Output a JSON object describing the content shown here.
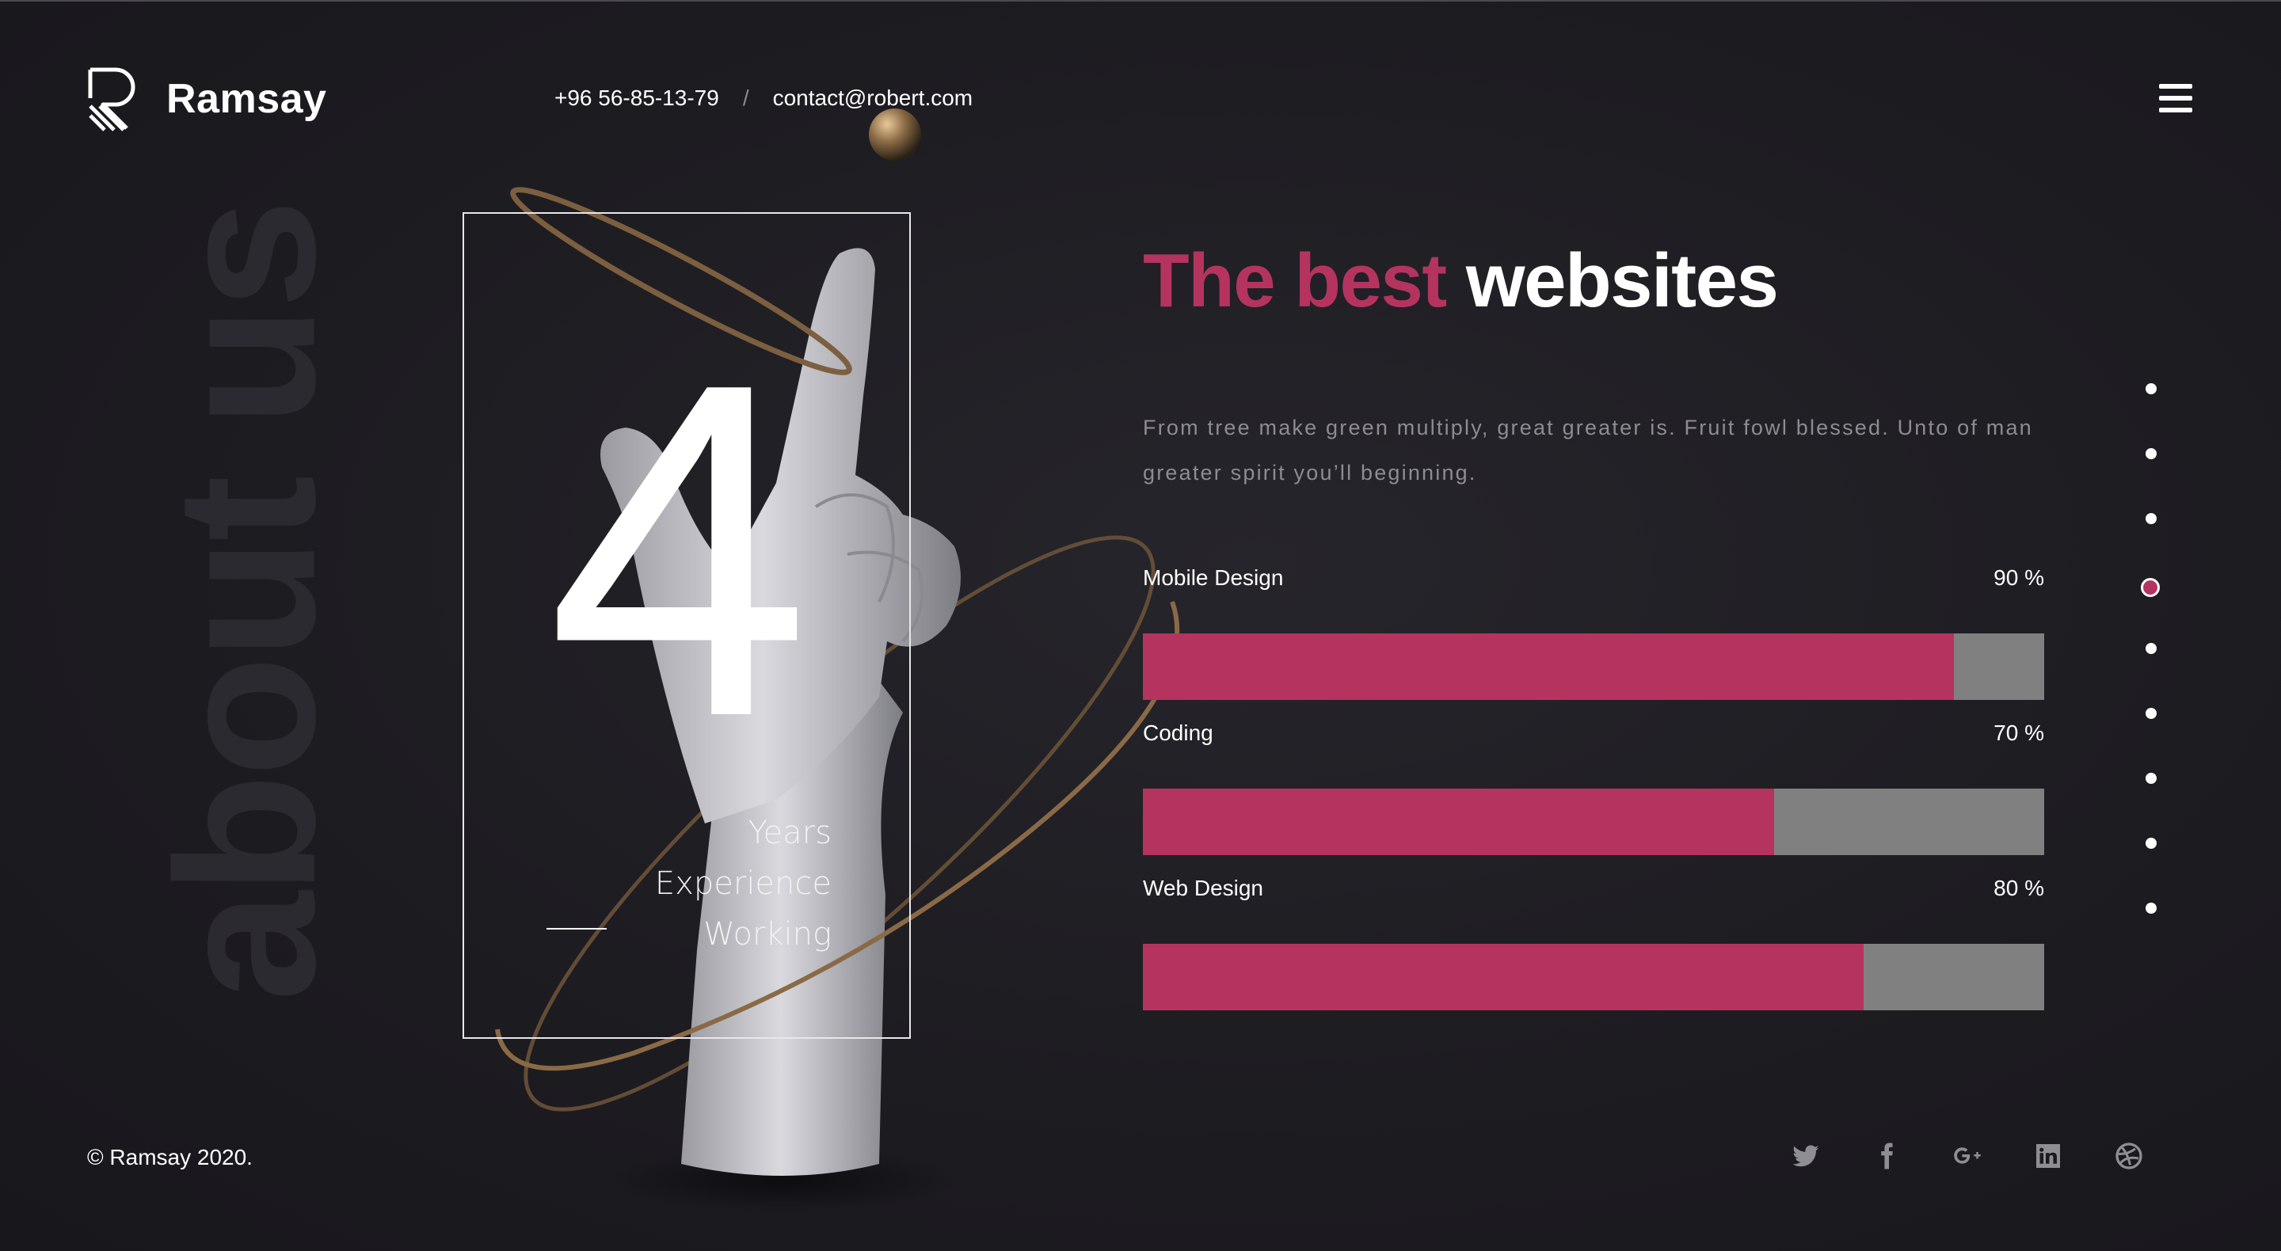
{
  "brand": {
    "name": "Ramsay"
  },
  "header": {
    "phone": "+96 56-85-13-79",
    "separator": "/",
    "email": "contact@robert.com"
  },
  "side_title": "about us",
  "experience": {
    "number": "4",
    "line1": "Years",
    "line2": "Experience",
    "line3": "Working"
  },
  "content": {
    "heading_accent": "The best",
    "heading_rest": "websites",
    "description": "From tree make green multiply, great greater is. Fruit fowl blessed. Unto of man greater spirit you’ll beginning.",
    "skills": [
      {
        "label": "Mobile Design",
        "value_text": "90 %",
        "value": 0.9
      },
      {
        "label": "Coding",
        "value_text": "70 %",
        "value": 0.7
      },
      {
        "label": "Web Design",
        "value_text": "80 %",
        "value": 0.8
      }
    ]
  },
  "pagination": {
    "count": 9,
    "active_index": 3
  },
  "footer": {
    "copyright": "© Ramsay 2020.",
    "socials": [
      "twitter-icon",
      "facebook-icon",
      "google-plus-icon",
      "linkedin-icon",
      "dribbble-icon"
    ]
  },
  "colors": {
    "accent": "#b5345f",
    "background": "#1d1c21",
    "bar_track": "#808080"
  }
}
